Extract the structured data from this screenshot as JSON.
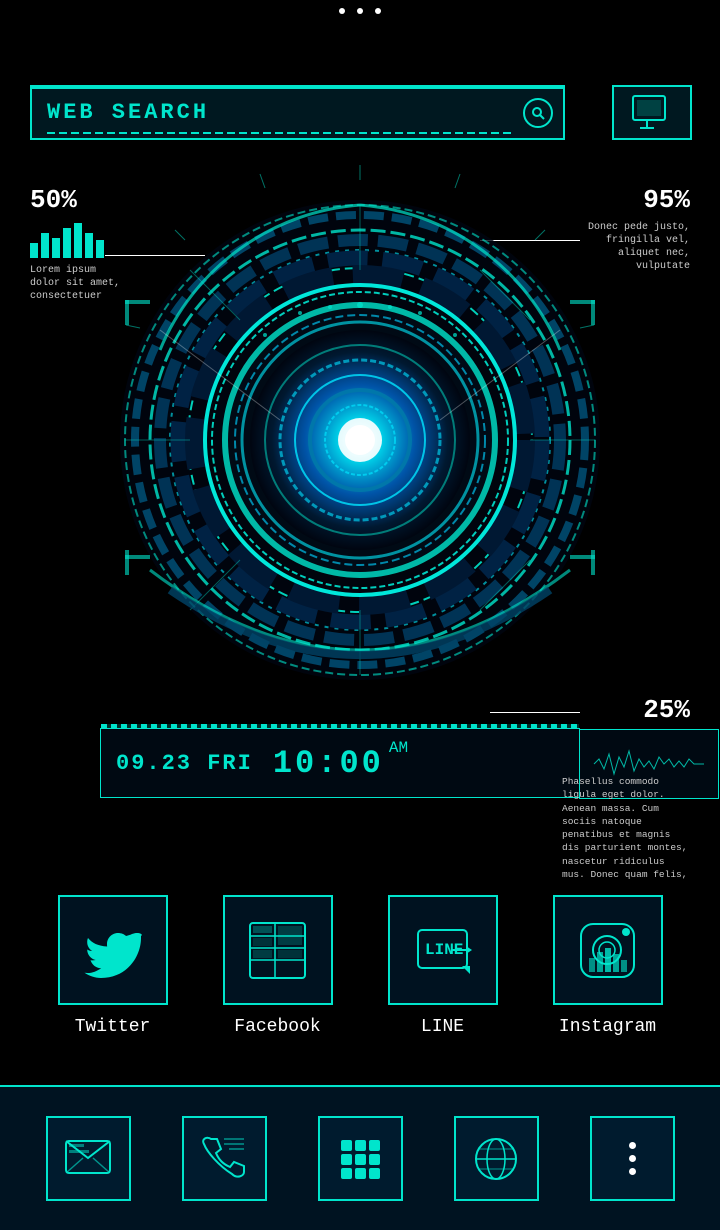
{
  "statusBar": {
    "dots": 3
  },
  "header": {
    "searchLabel": "WEB SEARCH",
    "searchPlaceholder": "WEB SEARCH"
  },
  "stats": {
    "left": {
      "percent": "50%",
      "desc": "Lorem ipsum dolor sit amet, consectetuer",
      "bars": [
        15,
        25,
        20,
        30,
        35,
        25,
        18
      ]
    },
    "right": {
      "percent": "95%",
      "desc": "Donec pede justo, fringilla vel, aliquet nec, vulputate"
    },
    "bottomRight": {
      "percent": "25%",
      "desc": "Phasellus commodo ligula eget dolor. Aenean massa. Cum sociis natoque penatibus et magnis dis parturient montes, nascetur ridiculus mus. Donec quam felis,"
    }
  },
  "datetime": {
    "date": "09.23 FRI",
    "time": "10:00",
    "ampm": "AM"
  },
  "apps": [
    {
      "id": "twitter",
      "label": "Twitter"
    },
    {
      "id": "facebook",
      "label": "Facebook"
    },
    {
      "id": "line",
      "label": "LINE"
    },
    {
      "id": "instagram",
      "label": "Instagram"
    }
  ],
  "dock": [
    {
      "id": "messages",
      "icon": "mail"
    },
    {
      "id": "phone",
      "icon": "phone"
    },
    {
      "id": "apps",
      "icon": "grid"
    },
    {
      "id": "browser",
      "icon": "globe"
    },
    {
      "id": "more",
      "icon": "dots"
    }
  ]
}
